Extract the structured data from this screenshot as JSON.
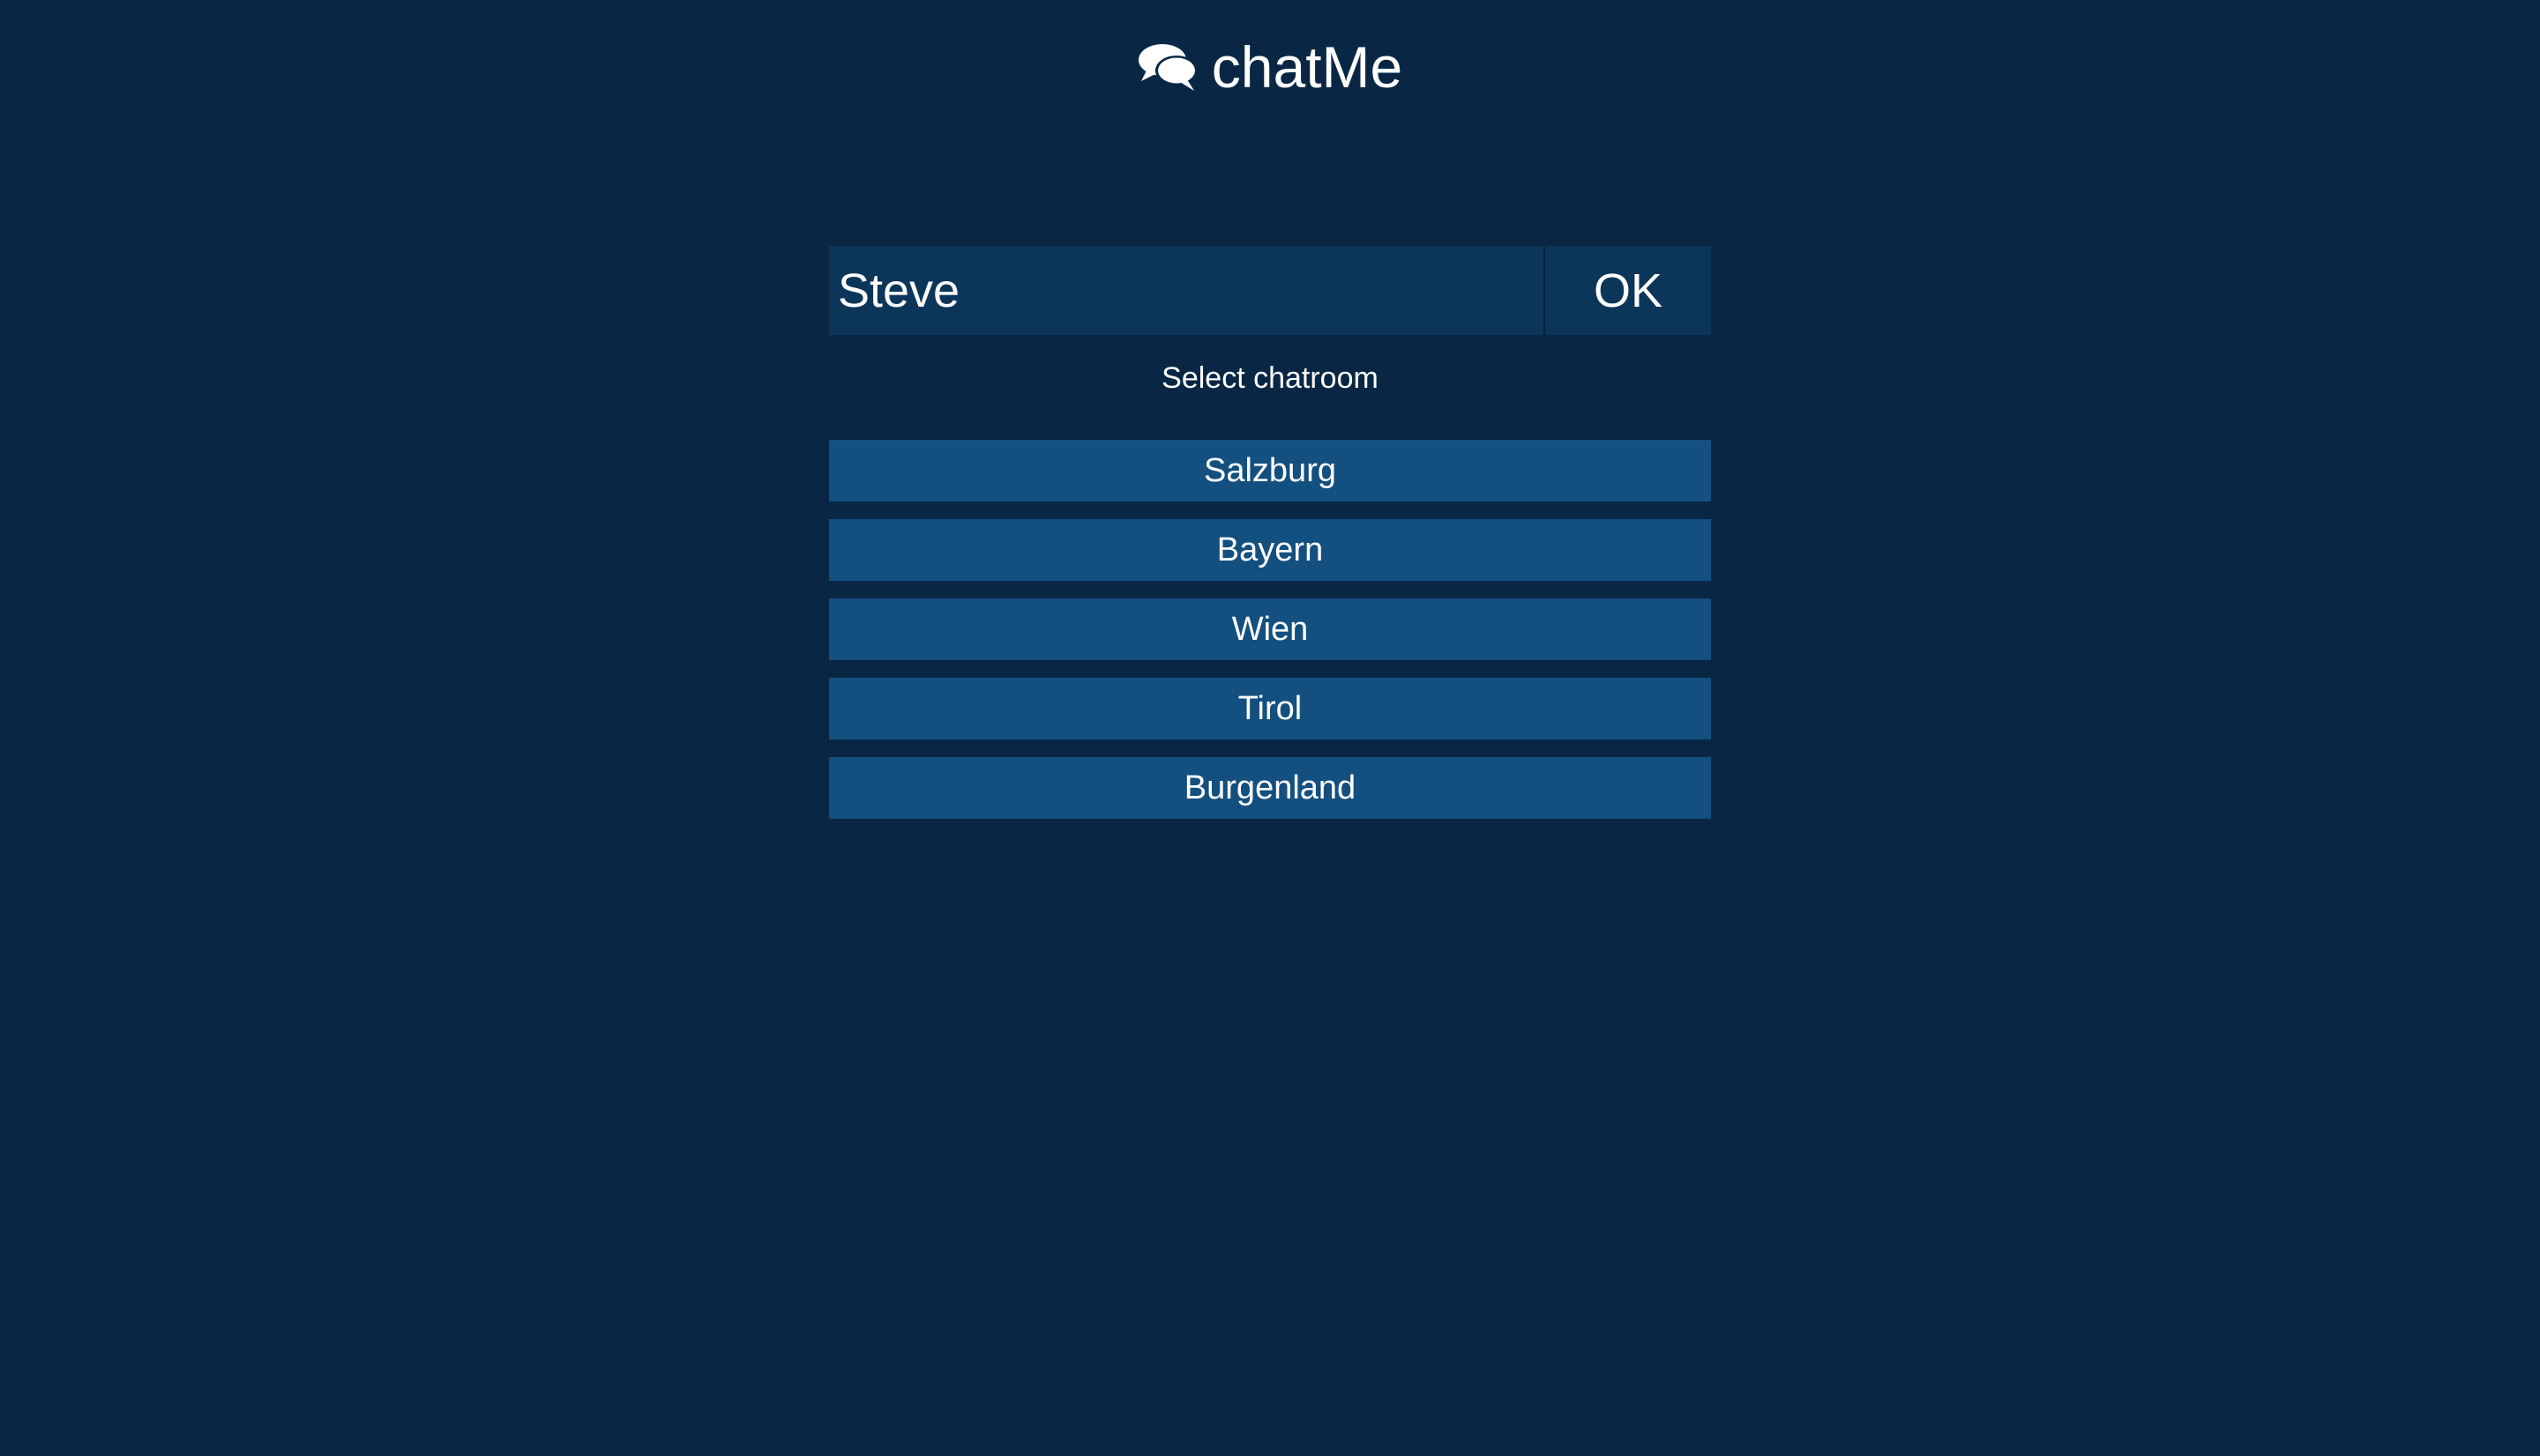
{
  "app": {
    "title": "chatMe",
    "logo_icon": "chat-bubbles-icon"
  },
  "login": {
    "name_value": "Steve",
    "ok_label": "OK"
  },
  "rooms": {
    "heading": "Select chatroom",
    "items": [
      {
        "label": "Salzburg"
      },
      {
        "label": "Bayern"
      },
      {
        "label": "Wien"
      },
      {
        "label": "Tirol"
      },
      {
        "label": "Burgenland"
      }
    ]
  },
  "colors": {
    "background": "#092744",
    "input_background": "#0c355a",
    "room_button": "#134f7f",
    "text": "#ffffff"
  }
}
